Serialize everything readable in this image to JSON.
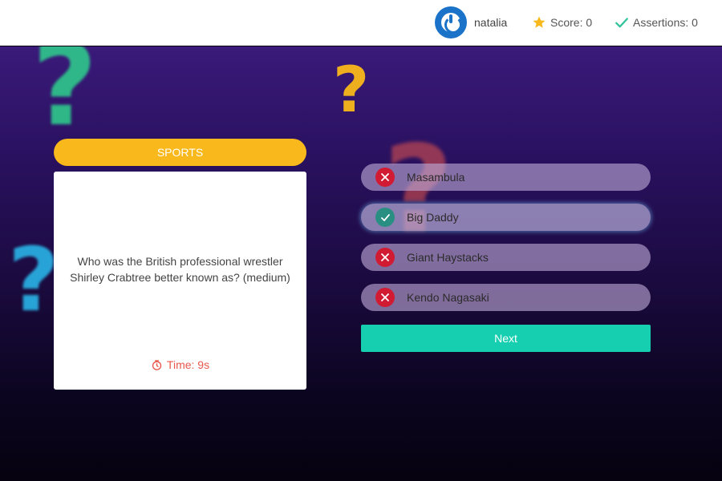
{
  "header": {
    "username": "natalia",
    "score_label": "Score: 0",
    "assertions_label": "Assertions: 0",
    "avatar_color": "#1a73c8"
  },
  "question": {
    "category": "SPORTS",
    "text": "Who was the British professional wrestler Shirley Crabtree better known as? (medium)",
    "timer_label": "Time: 9s",
    "category_color": "#f9b81b"
  },
  "answers": [
    {
      "label": "Masambula",
      "status": "incorrect",
      "icon": "x-icon"
    },
    {
      "label": "Big Daddy",
      "status": "correct",
      "icon": "check-icon"
    },
    {
      "label": "Giant Haystacks",
      "status": "incorrect",
      "icon": "x-icon"
    },
    {
      "label": "Kendo Nagasaki",
      "status": "incorrect",
      "icon": "x-icon"
    }
  ],
  "next_button": {
    "label": "Next",
    "color": "#15cfb0"
  },
  "background": {
    "glyph": "?",
    "colors": [
      "#2fc98c",
      "#f9b81b",
      "#e8574e",
      "#2ab4e8"
    ]
  },
  "icons": {
    "score": "star-icon",
    "assertions": "check-icon",
    "timer": "stopwatch-icon"
  }
}
